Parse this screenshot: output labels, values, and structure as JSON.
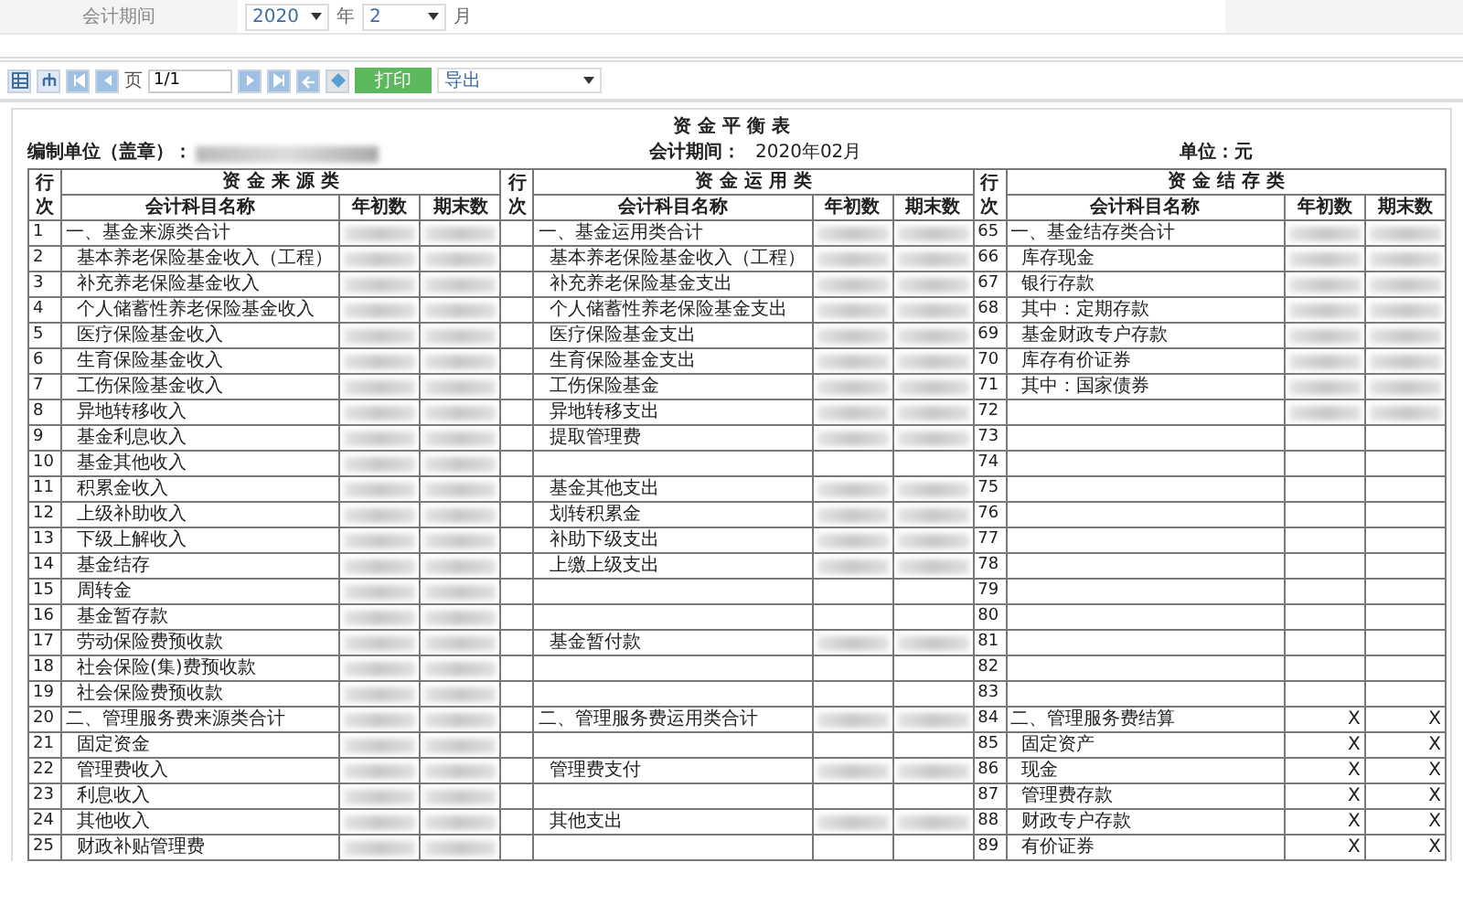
{
  "filter": {
    "label": "会计期间",
    "year": "2020",
    "year_unit": "年",
    "month": "2",
    "month_unit": "月"
  },
  "toolbar": {
    "page_label": "页",
    "page": "1/1",
    "print": "打印",
    "export": "导出"
  },
  "report": {
    "title": "资 金 平 衡 表",
    "unit_label": "编制单位（盖章）：",
    "period_label": "会计期间：",
    "period": "2020年02月",
    "currency": "单位：元",
    "sections": [
      {
        "no_header": "行次",
        "title": "资 金 来 源 类",
        "columns": [
          "会计科目名称",
          "年初数",
          "期末数"
        ]
      },
      {
        "no_header": "行次",
        "title": "资 金 运 用 类",
        "columns": [
          "会计科目名称",
          "年初数",
          "期末数"
        ]
      },
      {
        "no_header": "行次",
        "title": "资 金 结 存 类",
        "columns": [
          "会计科目名称",
          "年初数",
          "期末数"
        ]
      }
    ],
    "rows": [
      {
        "source": {
          "no": "1",
          "name": "一、基金来源类合计",
          "kind": "total",
          "redacted": true
        },
        "use": {
          "name": "一、基金运用类合计",
          "kind": "total",
          "redacted": true
        },
        "balance": {
          "no": "65",
          "name": "一、基金结存类合计",
          "kind": "total",
          "redacted": true
        }
      },
      {
        "source": {
          "no": "2",
          "name": "基本养老保险基金收入（工程）",
          "kind": "item",
          "redacted": true
        },
        "use": {
          "name": "基本养老保险基金收入（工程）",
          "kind": "item",
          "redacted": true
        },
        "balance": {
          "no": "66",
          "name": "库存现金",
          "kind": "item",
          "redacted": true
        }
      },
      {
        "source": {
          "no": "3",
          "name": "补充养老保险基金收入",
          "kind": "item",
          "redacted": true
        },
        "use": {
          "name": "补充养老保险基金支出",
          "kind": "item",
          "redacted": true
        },
        "balance": {
          "no": "67",
          "name": "银行存款",
          "kind": "item",
          "redacted": true
        }
      },
      {
        "source": {
          "no": "4",
          "name": "个人储蓄性养老保险基金收入",
          "kind": "item",
          "redacted": true
        },
        "use": {
          "name": "个人储蓄性养老保险基金支出",
          "kind": "item",
          "redacted": true
        },
        "balance": {
          "no": "68",
          "name": "其中：定期存款",
          "kind": "item",
          "redacted": true
        }
      },
      {
        "source": {
          "no": "5",
          "name": "医疗保险基金收入",
          "kind": "item",
          "redacted": true
        },
        "use": {
          "name": "医疗保险基金支出",
          "kind": "item",
          "redacted": true
        },
        "balance": {
          "no": "69",
          "name": "基金财政专户存款",
          "kind": "item",
          "redacted": true
        }
      },
      {
        "source": {
          "no": "6",
          "name": "生育保险基金收入",
          "kind": "item",
          "redacted": true
        },
        "use": {
          "name": "生育保险基金支出",
          "kind": "item",
          "redacted": true
        },
        "balance": {
          "no": "70",
          "name": "库存有价证券",
          "kind": "item",
          "redacted": true
        }
      },
      {
        "source": {
          "no": "7",
          "name": "工伤保险基金收入",
          "kind": "item",
          "redacted": true
        },
        "use": {
          "name": "工伤保险基金",
          "kind": "item",
          "redacted": true
        },
        "balance": {
          "no": "71",
          "name": "其中：国家债券",
          "kind": "item",
          "redacted": true
        }
      },
      {
        "source": {
          "no": "8",
          "name": "异地转移收入",
          "kind": "item",
          "redacted": true
        },
        "use": {
          "name": "异地转移支出",
          "kind": "item",
          "redacted": true
        },
        "balance": {
          "no": "72",
          "kind": "item",
          "redacted": true
        }
      },
      {
        "source": {
          "no": "9",
          "name": "基金利息收入",
          "kind": "item",
          "redacted": true
        },
        "use": {
          "name": "提取管理费",
          "kind": "item",
          "redacted": true
        },
        "balance": {
          "no": "73",
          "kind": "item",
          "redacted": false
        }
      },
      {
        "source": {
          "no": "10",
          "name": "基金其他收入",
          "kind": "item",
          "redacted": true
        },
        "use": {
          "kind": "item",
          "redacted": false
        },
        "balance": {
          "no": "74",
          "kind": "item",
          "redacted": false
        }
      },
      {
        "source": {
          "no": "11",
          "name": "积累金收入",
          "kind": "item",
          "redacted": true
        },
        "use": {
          "name": "基金其他支出",
          "kind": "item",
          "redacted": true
        },
        "balance": {
          "no": "75",
          "kind": "item",
          "redacted": false
        }
      },
      {
        "source": {
          "no": "12",
          "name": "上级补助收入",
          "kind": "item",
          "redacted": true
        },
        "use": {
          "name": "划转积累金",
          "kind": "item",
          "redacted": true
        },
        "balance": {
          "no": "76",
          "kind": "item",
          "redacted": false
        }
      },
      {
        "source": {
          "no": "13",
          "name": "下级上解收入",
          "kind": "item",
          "redacted": true
        },
        "use": {
          "name": "补助下级支出",
          "kind": "item",
          "redacted": true
        },
        "balance": {
          "no": "77",
          "kind": "item",
          "redacted": false
        }
      },
      {
        "source": {
          "no": "14",
          "name": "基金结存",
          "kind": "item",
          "redacted": true
        },
        "use": {
          "name": "上缴上级支出",
          "kind": "item",
          "redacted": true
        },
        "balance": {
          "no": "78",
          "kind": "item",
          "redacted": false
        }
      },
      {
        "source": {
          "no": "15",
          "name": "周转金",
          "kind": "item",
          "redacted": true
        },
        "use": {
          "kind": "item",
          "redacted": false
        },
        "balance": {
          "no": "79",
          "kind": "item",
          "redacted": false
        }
      },
      {
        "source": {
          "no": "16",
          "name": "基金暂存款",
          "kind": "item",
          "redacted": true
        },
        "use": {
          "kind": "item",
          "redacted": false
        },
        "balance": {
          "no": "80",
          "kind": "item",
          "redacted": false
        }
      },
      {
        "source": {
          "no": "17",
          "name": "劳动保险费预收款",
          "kind": "item",
          "redacted": true
        },
        "use": {
          "name": "基金暂付款",
          "kind": "item",
          "redacted": true
        },
        "balance": {
          "no": "81",
          "kind": "item",
          "redacted": false
        }
      },
      {
        "source": {
          "no": "18",
          "name": "社会保险(集)费预收款",
          "kind": "item",
          "redacted": true
        },
        "use": {
          "kind": "item",
          "redacted": false
        },
        "balance": {
          "no": "82",
          "kind": "item",
          "redacted": false
        }
      },
      {
        "source": {
          "no": "19",
          "name": "社会保险费预收款",
          "kind": "item",
          "redacted": true
        },
        "use": {
          "kind": "item",
          "redacted": false
        },
        "balance": {
          "no": "83",
          "kind": "item",
          "redacted": false
        }
      },
      {
        "source": {
          "no": "20",
          "name": "二、管理服务费来源类合计",
          "kind": "total",
          "redacted": true
        },
        "use": {
          "name": "二、管理服务费运用类合计",
          "kind": "total",
          "redacted": true
        },
        "balance": {
          "no": "84",
          "name": "二、管理服务费结算",
          "kind": "total",
          "redacted": false,
          "begin": "X",
          "end": "X"
        }
      },
      {
        "source": {
          "no": "21",
          "name": "固定资金",
          "kind": "item",
          "redacted": true
        },
        "use": {
          "kind": "item",
          "redacted": false
        },
        "balance": {
          "no": "85",
          "name": "固定资产",
          "kind": "item",
          "redacted": false,
          "begin": "X",
          "end": "X"
        }
      },
      {
        "source": {
          "no": "22",
          "name": "管理费收入",
          "kind": "item",
          "redacted": true
        },
        "use": {
          "name": "管理费支付",
          "kind": "item",
          "redacted": true
        },
        "balance": {
          "no": "86",
          "name": "现金",
          "kind": "item",
          "redacted": false,
          "begin": "X",
          "end": "X"
        }
      },
      {
        "source": {
          "no": "23",
          "name": "利息收入",
          "kind": "item",
          "redacted": true
        },
        "use": {
          "kind": "item",
          "redacted": false
        },
        "balance": {
          "no": "87",
          "name": "管理费存款",
          "kind": "item",
          "redacted": false,
          "begin": "X",
          "end": "X"
        }
      },
      {
        "source": {
          "no": "24",
          "name": "其他收入",
          "kind": "item",
          "redacted": true
        },
        "use": {
          "name": "其他支出",
          "kind": "item",
          "redacted": true
        },
        "balance": {
          "no": "88",
          "name": "财政专户存款",
          "kind": "item",
          "redacted": false,
          "begin": "X",
          "end": "X"
        }
      },
      {
        "source": {
          "no": "25",
          "name": "财政补贴管理费",
          "kind": "item",
          "redacted": true
        },
        "use": {
          "kind": "item",
          "redacted": false
        },
        "balance": {
          "no": "89",
          "name": "有价证券",
          "kind": "item",
          "redacted": false,
          "begin": "X",
          "end": "X"
        }
      }
    ]
  }
}
